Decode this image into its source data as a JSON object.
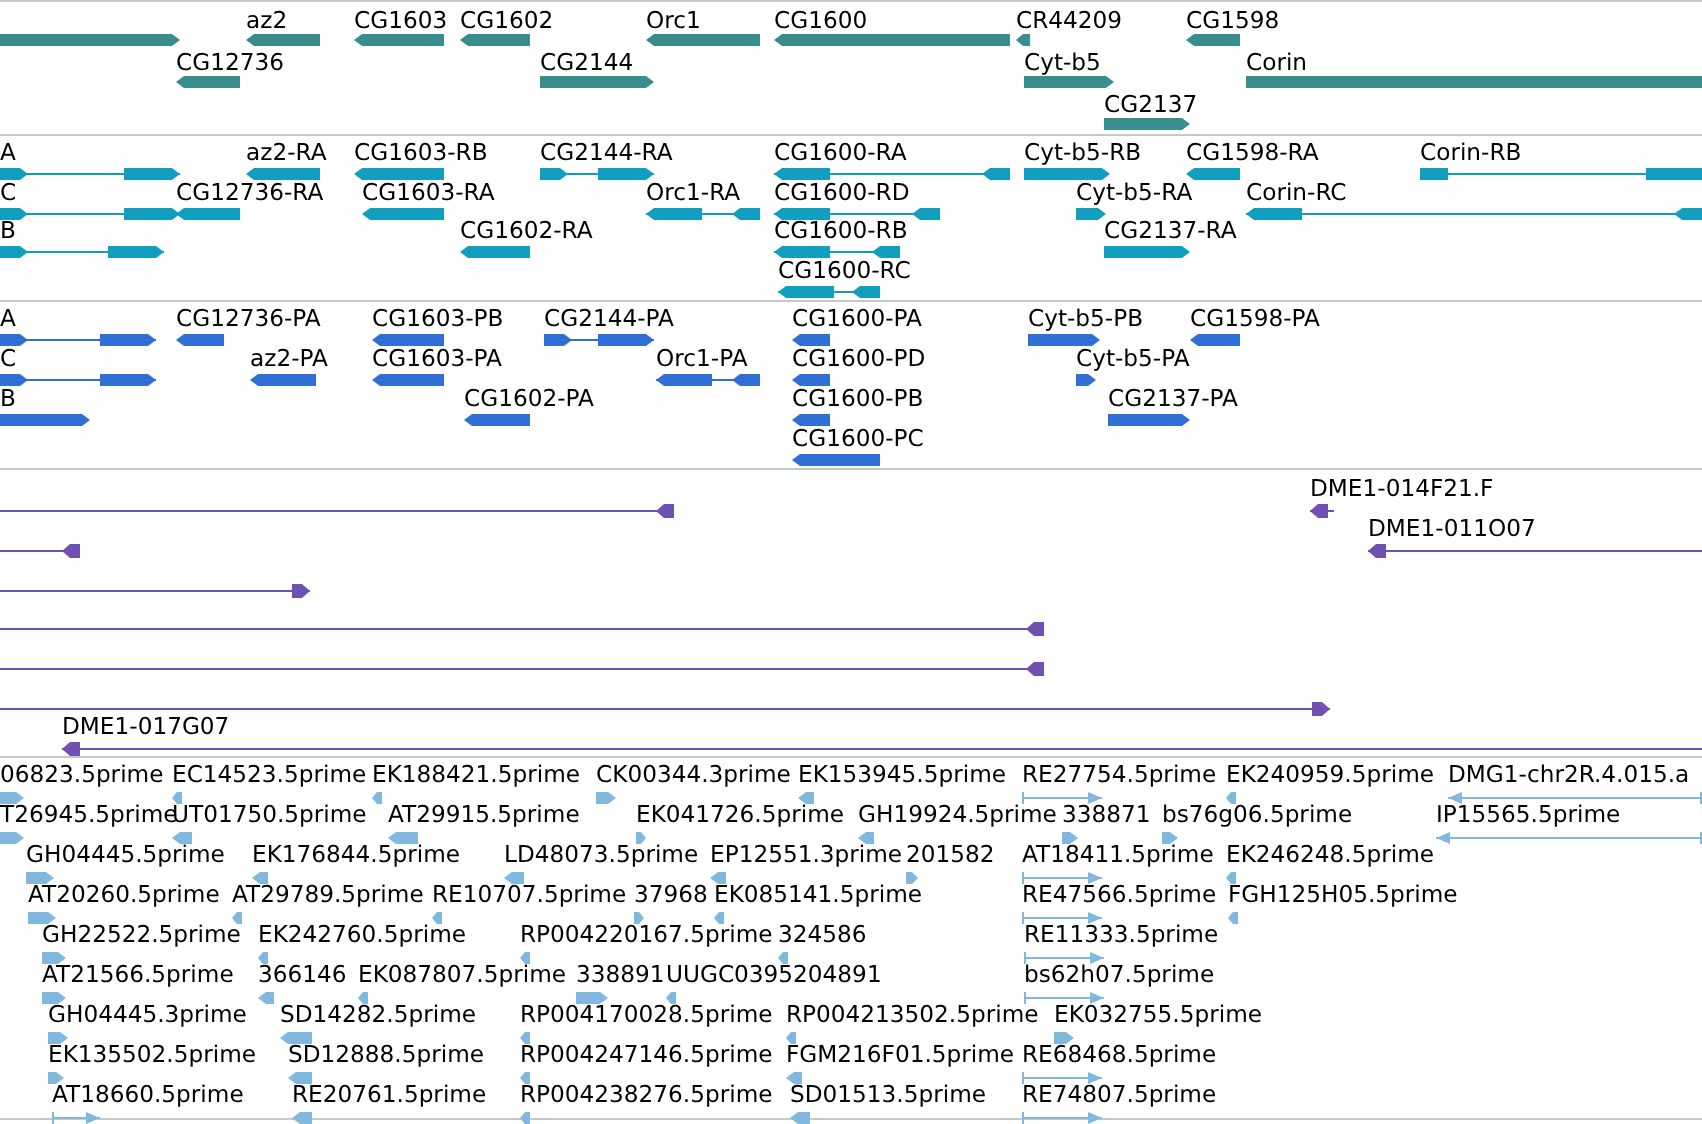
{
  "tracks": [
    {
      "kind": "gene",
      "color": "#3a8d8d",
      "features": [
        {
          "points_left": false,
          "points_right": true
        },
        {
          "label": "az2",
          "points_left": true,
          "points_right": false
        },
        {
          "label": "CG1603",
          "points_left": true,
          "points_right": false
        },
        {
          "label": "CG1602",
          "points_left": true,
          "points_right": false
        },
        {
          "label": "Orc1",
          "points_left": true,
          "points_right": false
        },
        {
          "label": "CG1600",
          "points_left": true,
          "points_right": false
        },
        {
          "label": "CR44209",
          "points_left": true,
          "points_right": false
        },
        {
          "label": "CG1598",
          "points_left": true,
          "points_right": false
        },
        {
          "label": "CG12736",
          "points_left": true,
          "points_right": false
        },
        {
          "label": "CG2144",
          "points_left": false,
          "points_right": true
        },
        {
          "label": "Cyt-b5",
          "points_left": false,
          "points_right": true
        },
        {
          "label": "Corin",
          "points_left": false,
          "points_right": false
        },
        {
          "label": "CG2137",
          "points_left": false,
          "points_right": true
        }
      ]
    },
    {
      "kind": "transcript",
      "color": "#129fbf",
      "features": [
        {
          "label": "A",
          "points_left": false,
          "points_right": true
        },
        {
          "label": "az2-RA",
          "points_left": true,
          "points_right": false
        },
        {
          "label": "CG1603-RB",
          "points_left": true,
          "points_right": false
        },
        {
          "label": "CG2144-RA",
          "points_left": false,
          "points_right": true
        },
        {
          "label": "CG1600-RA",
          "points_left": true,
          "points_right": false
        },
        {
          "label": "Cyt-b5-RB",
          "points_left": false,
          "points_right": true
        },
        {
          "label": "CG1598-RA",
          "points_left": true,
          "points_right": false
        },
        {
          "label": "Corin-RB",
          "points_left": false,
          "points_right": false
        },
        {
          "label": "C",
          "points_left": false,
          "points_right": true
        },
        {
          "label": "CG12736-RA",
          "points_left": true,
          "points_right": false
        },
        {
          "label": "CG1603-RA",
          "points_left": true,
          "points_right": false
        },
        {
          "label": "Orc1-RA",
          "points_left": true,
          "points_right": false
        },
        {
          "label": "CG1600-RD",
          "points_left": true,
          "points_right": false
        },
        {
          "label": "Cyt-b5-RA",
          "points_left": false,
          "points_right": true
        },
        {
          "label": "Corin-RC",
          "points_left": true,
          "points_right": false
        },
        {
          "label": "B",
          "points_left": false,
          "points_right": true
        },
        {
          "label": "CG1602-RA",
          "points_left": true,
          "points_right": false
        },
        {
          "label": "CG1600-RB",
          "points_left": true,
          "points_right": false
        },
        {
          "label": "CG2137-RA",
          "points_left": false,
          "points_right": true
        },
        {
          "label": "CG1600-RC",
          "points_left": true,
          "points_right": false
        }
      ]
    },
    {
      "kind": "protein",
      "color": "#2f6fd6",
      "features": [
        {
          "label": "A",
          "points_left": false,
          "points_right": true
        },
        {
          "label": "CG12736-PA",
          "points_left": true,
          "points_right": false
        },
        {
          "label": "CG1603-PB",
          "points_left": true,
          "points_right": false
        },
        {
          "label": "CG2144-PA",
          "points_left": false,
          "points_right": true
        },
        {
          "label": "CG1600-PA",
          "points_left": true,
          "points_right": false
        },
        {
          "label": "Cyt-b5-PB",
          "points_left": false,
          "points_right": true
        },
        {
          "label": "CG1598-PA",
          "points_left": true,
          "points_right": false
        },
        {
          "label": "C",
          "points_left": false,
          "points_right": true
        },
        {
          "label": "az2-PA",
          "points_left": true,
          "points_right": false
        },
        {
          "label": "CG1603-PA",
          "points_left": true,
          "points_right": false
        },
        {
          "label": "Orc1-PA",
          "points_left": true,
          "points_right": false
        },
        {
          "label": "CG1600-PD",
          "points_left": true,
          "points_right": false
        },
        {
          "label": "Cyt-b5-PA",
          "points_left": false,
          "points_right": true
        },
        {
          "label": "B",
          "points_left": false,
          "points_right": true
        },
        {
          "label": "CG1602-PA",
          "points_left": true,
          "points_right": false
        },
        {
          "label": "CG1600-PB",
          "points_left": true,
          "points_right": false
        },
        {
          "label": "CG2137-PA",
          "points_left": false,
          "points_right": true
        },
        {
          "label": "CG1600-PC",
          "points_left": true,
          "points_right": false
        }
      ]
    },
    {
      "kind": "clone",
      "color": "#7050b0",
      "features": [
        {
          "points_left": true,
          "points_right": false
        },
        {
          "label": "DME1-014F21.F",
          "points_left": true,
          "points_right": false
        },
        {
          "points_left": true,
          "points_right": false
        },
        {
          "label": "DME1-011O07",
          "points_left": true,
          "points_right": false
        },
        {
          "points_left": false,
          "points_right": true
        },
        {
          "points_left": true,
          "points_right": false
        },
        {
          "points_left": true,
          "points_right": false
        },
        {
          "points_left": false,
          "points_right": true
        },
        {
          "label": "DME1-017G07",
          "points_left": true,
          "points_right": false
        }
      ]
    },
    {
      "kind": "est",
      "color": "#80b8e0",
      "features": [
        {
          "label": "06823.5prime",
          "points_left": false,
          "points_right": true
        },
        {
          "label": "EC14523.5prime",
          "points_left": true,
          "points_right": false
        },
        {
          "label": "EK188421.5prime",
          "points_left": true,
          "points_right": false
        },
        {
          "label": "CK00344.3prime",
          "points_left": false,
          "points_right": true
        },
        {
          "label": "EK153945.5prime",
          "points_left": true,
          "points_right": false
        },
        {
          "label": "RE27754.5prime",
          "points_left": false,
          "points_right": true
        },
        {
          "label": "EK240959.5prime",
          "points_left": true,
          "points_right": false
        },
        {
          "label": "DMG1-chr2R.4.015.a",
          "points_left": true,
          "points_right": false
        },
        {
          "label": "T26945.5prime",
          "points_left": false,
          "points_right": true
        },
        {
          "label": "UT01750.5prime",
          "points_left": true,
          "points_right": false
        },
        {
          "label": "AT29915.5prime",
          "points_left": true,
          "points_right": false
        },
        {
          "label": "EK041726.5prime",
          "points_left": false,
          "points_right": true
        },
        {
          "label": "GH19924.5prime",
          "points_left": true,
          "points_right": false
        },
        {
          "label": "338871",
          "points_left": false,
          "points_right": true
        },
        {
          "label": "bs76g06.5prime",
          "points_left": false,
          "points_right": true
        },
        {
          "label": "IP15565.5prime",
          "points_left": true,
          "points_right": false
        },
        {
          "label": "GH04445.5prime",
          "points_left": false,
          "points_right": true
        },
        {
          "label": "EK176844.5prime",
          "points_left": true,
          "points_right": false
        },
        {
          "label": "LD48073.5prime",
          "points_left": true,
          "points_right": false
        },
        {
          "label": "EP12551.3prime",
          "points_left": true,
          "points_right": false
        },
        {
          "label": "201582",
          "points_left": false,
          "points_right": true
        },
        {
          "label": "AT18411.5prime",
          "points_left": false,
          "points_right": true
        },
        {
          "label": "EK246248.5prime",
          "points_left": true,
          "points_right": false
        },
        {
          "label": "AT20260.5prime",
          "points_left": false,
          "points_right": true
        },
        {
          "label": "AT29789.5prime",
          "points_left": true,
          "points_right": false
        },
        {
          "label": "RE10707.5prime",
          "points_left": true,
          "points_right": false
        },
        {
          "label": "37968",
          "points_left": false,
          "points_right": true
        },
        {
          "label": "EK085141.5prime",
          "points_left": true,
          "points_right": false
        },
        {
          "label": "RE47566.5prime",
          "points_left": false,
          "points_right": true
        },
        {
          "label": "FGH125H05.5prime",
          "points_left": true,
          "points_right": false
        },
        {
          "label": "GH22522.5prime",
          "points_left": false,
          "points_right": true
        },
        {
          "label": "EK242760.5prime",
          "points_left": true,
          "points_right": false
        },
        {
          "label": "RP004220167.5prime",
          "points_left": true,
          "points_right": false
        },
        {
          "label": "324586",
          "points_left": true,
          "points_right": false
        },
        {
          "label": "RE11333.5prime",
          "points_left": false,
          "points_right": true
        },
        {
          "label": "AT21566.5prime",
          "points_left": false,
          "points_right": true
        },
        {
          "label": "366146",
          "points_left": true,
          "points_right": false
        },
        {
          "label": "EK087807.5prime",
          "points_left": true,
          "points_right": false
        },
        {
          "label": "338891",
          "points_left": false,
          "points_right": true
        },
        {
          "label": "UUGC0395204891",
          "points_left": true,
          "points_right": false
        },
        {
          "label": "bs62h07.5prime",
          "points_left": false,
          "points_right": true
        },
        {
          "label": "GH04445.3prime",
          "points_left": false,
          "points_right": true
        },
        {
          "label": "SD14282.5prime",
          "points_left": true,
          "points_right": false
        },
        {
          "label": "RP004170028.5prime",
          "points_left": true,
          "points_right": false
        },
        {
          "label": "RP004213502.5prime",
          "points_left": true,
          "points_right": false
        },
        {
          "label": "EK032755.5prime",
          "points_left": false,
          "points_right": true
        },
        {
          "label": "EK135502.5prime",
          "points_left": false,
          "points_right": true
        },
        {
          "label": "SD12888.5prime",
          "points_left": true,
          "points_right": false
        },
        {
          "label": "RP004247146.5prime",
          "points_left": true,
          "points_right": false
        },
        {
          "label": "FGM216F01.5prime",
          "points_left": true,
          "points_right": false
        },
        {
          "label": "RE68468.5prime",
          "points_left": false,
          "points_right": true
        },
        {
          "label": "AT18660.5prime",
          "points_left": false,
          "points_right": true
        },
        {
          "label": "RE20761.5prime",
          "points_left": true,
          "points_right": false
        },
        {
          "label": "RP004238276.5prime",
          "points_left": true,
          "points_right": false
        },
        {
          "label": "SD01513.5prime",
          "points_left": true,
          "points_right": false
        },
        {
          "label": "RE74807.5prime",
          "points_left": false,
          "points_right": true
        }
      ]
    }
  ]
}
